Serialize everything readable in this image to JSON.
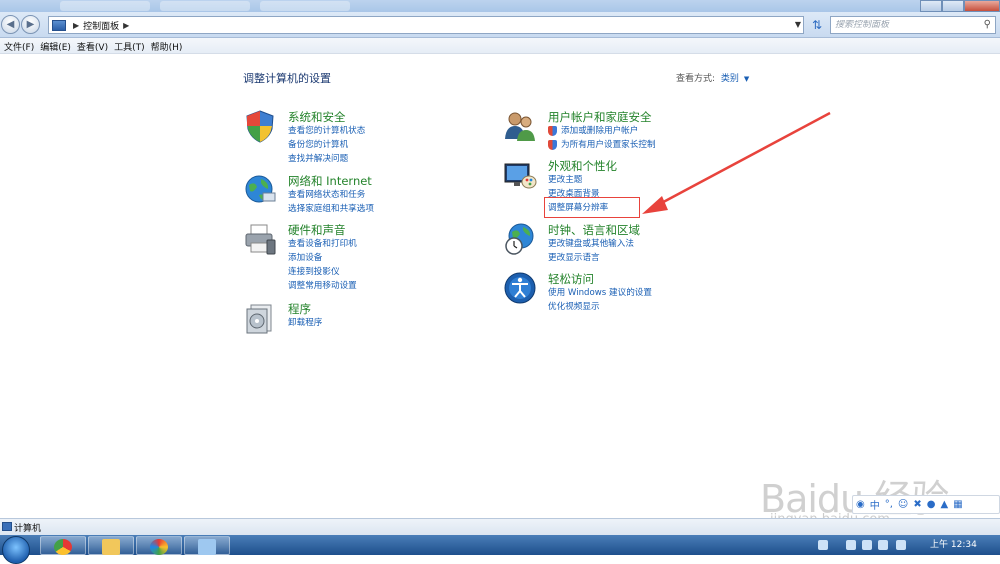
{
  "address": {
    "path_item": "控制面板",
    "search_placeholder": "搜索控制面板"
  },
  "menu": [
    "文件(F)",
    "编辑(E)",
    "查看(V)",
    "工具(T)",
    "帮助(H)"
  ],
  "page": {
    "heading": "调整计算机的设置",
    "view_by_label": "查看方式:",
    "view_by_value": "类别"
  },
  "categories": {
    "system": {
      "title": "系统和安全",
      "links": [
        "查看您的计算机状态",
        "备份您的计算机",
        "查找并解决问题"
      ]
    },
    "network": {
      "title": "网络和 Internet",
      "links": [
        "查看网络状态和任务",
        "选择家庭组和共享选项"
      ]
    },
    "hardware": {
      "title": "硬件和声音",
      "links": [
        "查看设备和打印机",
        "添加设备",
        "连接到投影仪",
        "调整常用移动设置"
      ]
    },
    "programs": {
      "title": "程序",
      "links": [
        "卸载程序"
      ]
    },
    "users": {
      "title": "用户帐户和家庭安全",
      "links": [
        "添加或删除用户帐户",
        "为所有用户设置家长控制"
      ]
    },
    "appearance": {
      "title": "外观和个性化",
      "links": [
        "更改主题",
        "更改桌面背景",
        "调整屏幕分辨率"
      ]
    },
    "clock": {
      "title": "时钟、语言和区域",
      "links": [
        "更改键盘或其他输入法",
        "更改显示语言"
      ]
    },
    "ease": {
      "title": "轻松访问",
      "links": [
        "使用 Windows 建议的设置",
        "优化视频显示"
      ]
    }
  },
  "statusbar": {
    "label": "计算机"
  },
  "taskbar": {
    "clock": "上午 12:34"
  },
  "watermark": {
    "brand": "Baidu 经验",
    "url": "jingyan.baidu.com"
  },
  "ime_toolbar": {
    "mode": "中"
  },
  "colors": {
    "link": "#1a5fb4",
    "category_title": "#24832b",
    "annotation": "#e8433c"
  }
}
